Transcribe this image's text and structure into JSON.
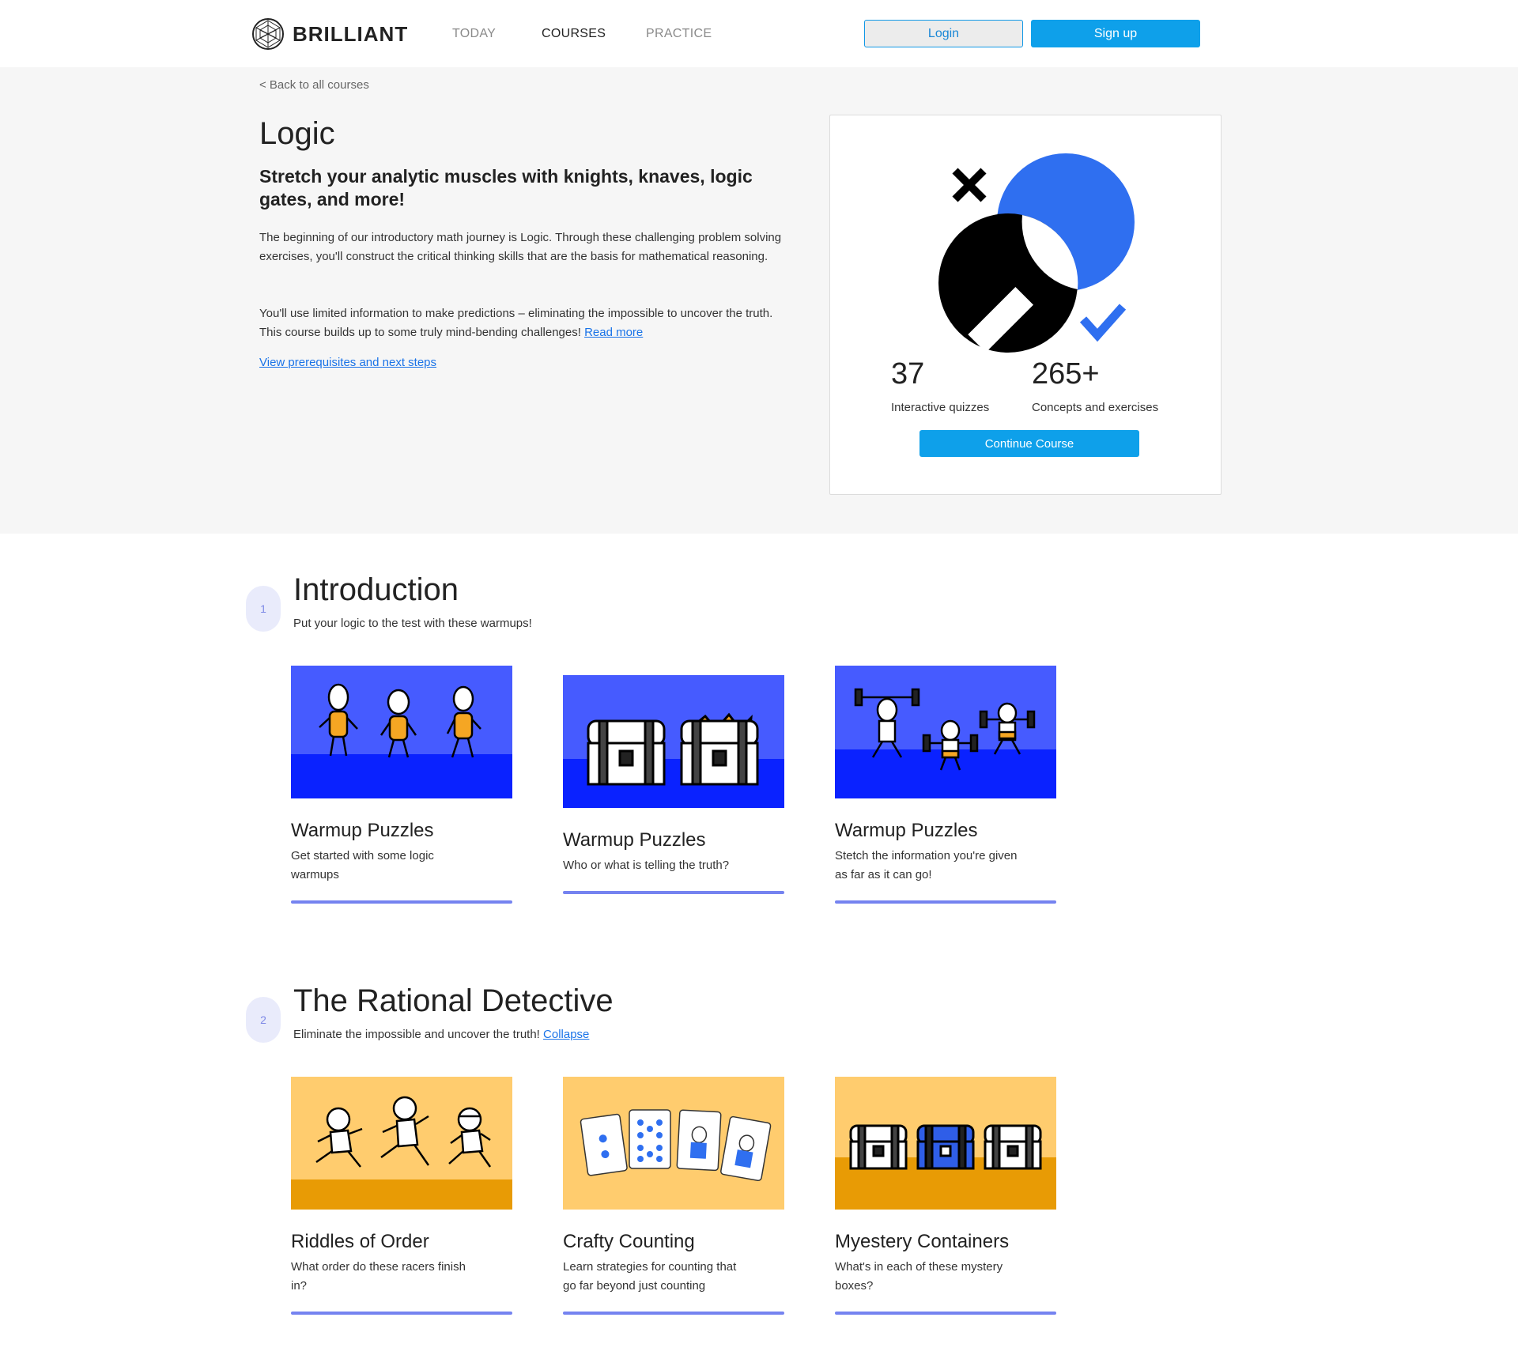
{
  "header": {
    "brand": "BRILLIANT",
    "nav": [
      {
        "label": "TODAY",
        "active": false
      },
      {
        "label": "COURSES",
        "active": true
      },
      {
        "label": "PRACTICE",
        "active": false
      }
    ],
    "login_label": "Login",
    "signup_label": "Sign up"
  },
  "hero": {
    "back_link": "< Back to all courses",
    "title": "Logic",
    "subtitle": "Stretch your analytic muscles with knights, knaves, logic gates, and more!",
    "description_1": "The beginning of our introductory math journey is Logic. Through these challenging problem solving exercises, you'll construct the critical thinking skills that are the basis for mathematical reasoning.",
    "description_2": "You'll use limited information to make predictions – eliminating the impossible to uncover the truth. This course builds up to some truly mind-bending challenges!",
    "read_more": "Read more",
    "prereq_link": "View prerequisites and next steps"
  },
  "course_card": {
    "stat1_value": "37",
    "stat1_label": "Interactive quizzes",
    "stat2_value": "265+",
    "stat2_label": "Concepts and exercises",
    "continue_label": "Continue Course"
  },
  "chapters": [
    {
      "number": "1",
      "title": "Introduction",
      "description": "Put your logic to the test with these warmups!",
      "tiles": [
        {
          "title": "Warmup Puzzles",
          "description": "Get started with some logic warmups",
          "scene": "three-characters-blue"
        },
        {
          "title": "Warmup Puzzles",
          "description": "Who or what is telling the truth?",
          "scene": "treasure-chests-blue"
        },
        {
          "title": "Warmup Puzzles",
          "description": "Stetch the information you're given as far as it can go!",
          "scene": "weightlifters-blue"
        }
      ]
    },
    {
      "number": "2",
      "title": "The Rational Detective",
      "description": "Eliminate the impossible and uncover the truth!",
      "collapse_link": "Collapse",
      "tiles": [
        {
          "title": "Riddles of Order",
          "description": "What order do these racers finish in?",
          "scene": "racers-yellow"
        },
        {
          "title": "Crafty Counting",
          "description": "Learn strategies for counting that go far beyond just counting",
          "scene": "playing-cards-yellow"
        },
        {
          "title": "Myestery Containers",
          "description": "What's in each of these mystery boxes?",
          "scene": "mystery-chests-yellow"
        }
      ]
    }
  ],
  "colors": {
    "accent": "#0ea0ea",
    "link": "#1a73e8",
    "tile_blue_top": "#465bff",
    "tile_blue_bottom": "#0a22ff",
    "tile_yellow_top": "#ffcc6e",
    "tile_yellow_bottom": "#e89b05",
    "progress_bar": "#7583f0"
  }
}
